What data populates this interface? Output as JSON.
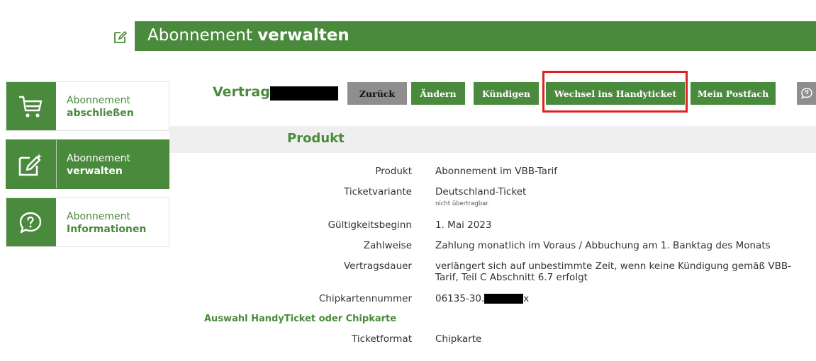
{
  "header": {
    "title_prefix": "Abonnement",
    "title_bold": "verwalten"
  },
  "sidebar": {
    "items": [
      {
        "line1": "Abonnement",
        "line2": "abschließen",
        "icon": "cart-icon"
      },
      {
        "line1": "Abonnement",
        "line2": "verwalten",
        "icon": "edit-icon"
      },
      {
        "line1": "Abonnement",
        "line2": "Informationen",
        "icon": "chat-question-icon"
      }
    ]
  },
  "contract": {
    "label": "Vertrag"
  },
  "buttons": {
    "back": "Zurück",
    "edit": "Ändern",
    "cancel": "Kündigen",
    "mobile": "Wechsel ins Handyticket",
    "mailbox": "Mein Postfach"
  },
  "product": {
    "section_title": "Produkt",
    "rows": {
      "product": {
        "label": "Produkt",
        "value": "Abonnement im VBB-Tarif"
      },
      "variant": {
        "label": "Ticketvariante",
        "value": "Deutschland-Ticket",
        "sub": "nicht übertragbar"
      },
      "start": {
        "label": "Gültigkeitsbeginn",
        "value": "1. Mai 2023"
      },
      "payment": {
        "label": "Zahlweise",
        "value": "Zahlung monatlich im Voraus / Abbuchung am 1. Banktag des Monats"
      },
      "duration": {
        "label": "Vertragsdauer",
        "value_line1": "verlängert sich auf unbestimmte Zeit, wenn keine Kündigung gemäß VBB-",
        "value_line2": "Tarif, Teil C Abschnitt 6.7 erfolgt"
      },
      "card": {
        "label": "Chipkartennummer",
        "value_prefix": "06135-30.",
        "value_suffix": "x"
      },
      "format": {
        "label": "Ticketformat",
        "value": "Chipkarte"
      }
    },
    "subsection_title": "Auswahl HandyTicket oder Chipkarte"
  }
}
